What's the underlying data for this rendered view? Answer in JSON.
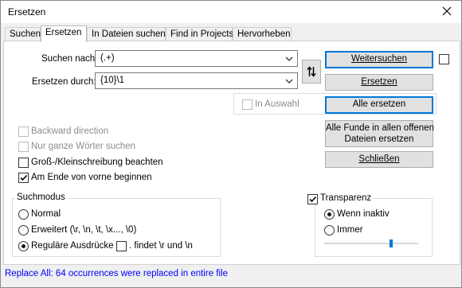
{
  "window": {
    "title": "Ersetzen"
  },
  "tabs": [
    {
      "label": "Suchen"
    },
    {
      "label": "Ersetzen"
    },
    {
      "label": "In Dateien suchen"
    },
    {
      "label": "Find in Projects"
    },
    {
      "label": "Hervorheben"
    }
  ],
  "search": {
    "label": "Suchen nach:",
    "value": "(.+)"
  },
  "replace": {
    "label": "Ersetzen durch:",
    "value": "{10}\\1"
  },
  "in_selection": {
    "label": "In Auswahl",
    "checked": false,
    "enabled": false
  },
  "buttons": {
    "find_next": "Weitersuchen",
    "replace": "Ersetzen",
    "replace_all": "Alle ersetzen",
    "replace_all_open_docs_line1": "Alle Funde in allen offenen",
    "replace_all_open_docs_line2": "Dateien ersetzen",
    "close": "Schließen"
  },
  "options": [
    {
      "label": "Backward direction",
      "checked": false,
      "enabled": false
    },
    {
      "label": "Nur ganze Wörter suchen",
      "checked": false,
      "enabled": false
    },
    {
      "label": "Groß-/Kleinschreibung beachten",
      "checked": false,
      "enabled": true
    },
    {
      "label": "Am Ende von vorne beginnen",
      "checked": true,
      "enabled": true
    }
  ],
  "search_mode": {
    "title": "Suchmodus",
    "normal": "Normal",
    "extended": "Erweitert (\\r, \\n, \\t, \\x..., \\0)",
    "regex": "Reguläre Ausdrücke",
    "dot_newline": ". findet \\r und \\n",
    "selected": "regex"
  },
  "transparency": {
    "label": "Transparenz",
    "checked": true,
    "on_inactive": "Wenn inaktiv",
    "always": "Immer",
    "selected": "on_inactive",
    "slider_level": 0.72
  },
  "status": "Replace All: 64 occurrences were replaced in entire file",
  "colors": {
    "accent": "#0078d7",
    "status_text": "#0000ff"
  }
}
